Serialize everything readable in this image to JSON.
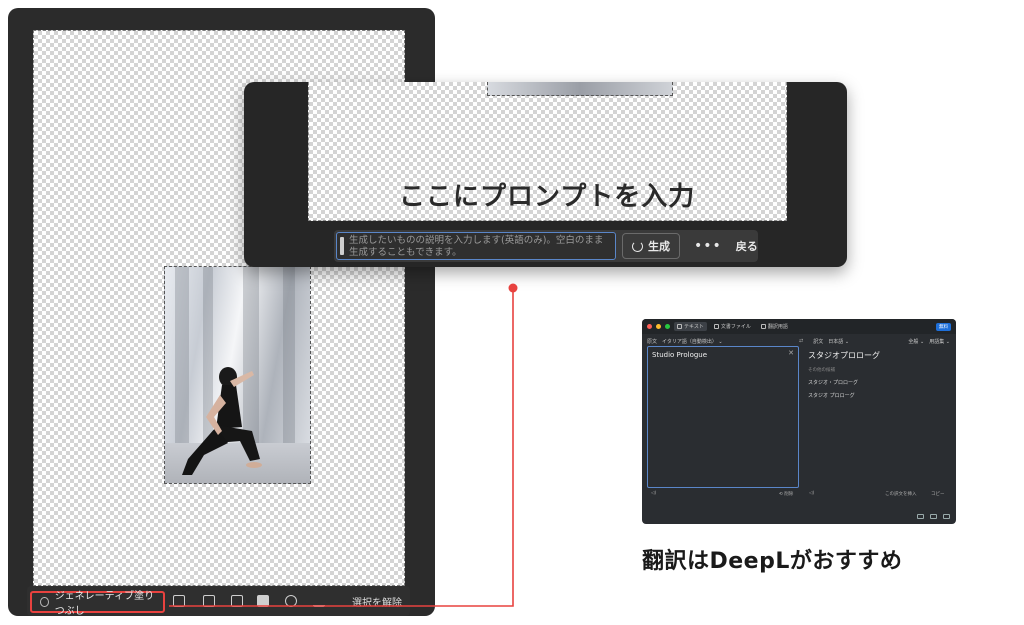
{
  "ps": {
    "generative_fill_label": "ジェネレーティブ塗りつぶし",
    "deselect_label": "選択を解除"
  },
  "zoom": {
    "overlay_label": "ここにプロンプトを入力",
    "prompt_placeholder": "生成したいものの説明を入力します(英語のみ)。空白のまま生成することもできます。",
    "generate_label": "生成",
    "more_label": "•••",
    "back_label": "戻る"
  },
  "deepl": {
    "tabs": [
      {
        "label": "テキスト"
      },
      {
        "label": "文書ファイル"
      },
      {
        "label": "翻訳用語"
      }
    ],
    "badge": "無料",
    "source_lang_prefix": "原文",
    "source_lang": "イタリア語（自動検出）",
    "target_lang_prefix": "訳文",
    "target_lang": "日本語",
    "formality": "全般",
    "glossary": "用語集",
    "source_text": "Studio Prologue",
    "target_text": "スタジオプロローグ",
    "alternatives_header": "その他の候補",
    "alternatives": [
      "スタジオ・プロローグ",
      "スタジオ プロローグ"
    ],
    "insert_label": "この訳文を挿入",
    "copy_label": "コピー",
    "clear_label": "削除"
  },
  "caption": "翻訳はDeepLがおすすめ",
  "colors": {
    "accent_red": "#e8423f",
    "input_blue": "#5a86c9",
    "ps_dark": "#2b2b2b",
    "deepl_badge": "#1e6fd9"
  }
}
